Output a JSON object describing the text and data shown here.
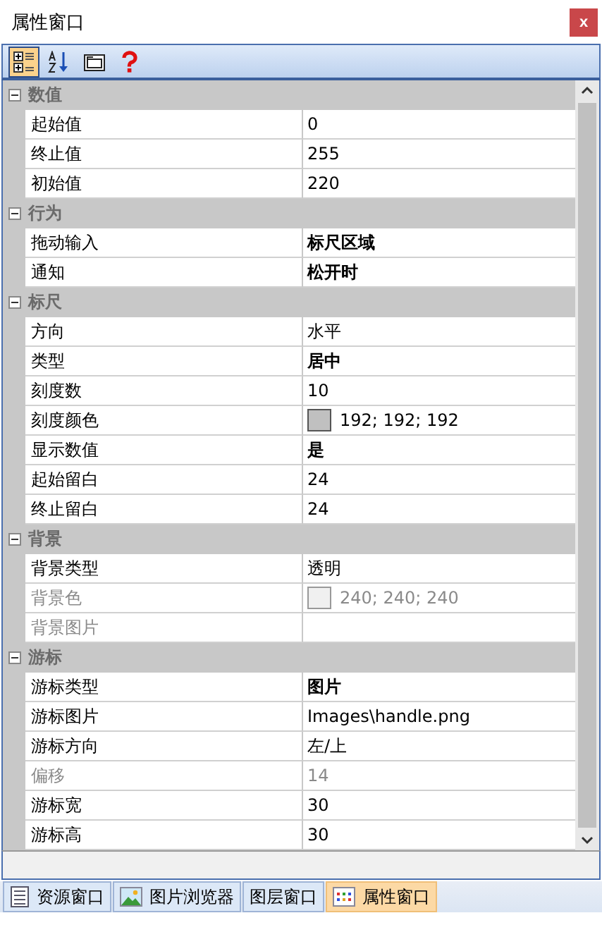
{
  "window": {
    "title": "属性窗口",
    "close": "x"
  },
  "toolbar": [
    {
      "kind": "categorized",
      "selected": true
    },
    {
      "kind": "alphabetical",
      "selected": false
    },
    {
      "kind": "pages",
      "selected": false
    },
    {
      "kind": "help",
      "selected": false
    }
  ],
  "categories": [
    {
      "name": "数值",
      "expanded": true,
      "properties": [
        {
          "name": "起始值",
          "value": "0",
          "bold": false,
          "disabled": false
        },
        {
          "name": "终止值",
          "value": "255",
          "bold": false,
          "disabled": false
        },
        {
          "name": "初始值",
          "value": "220",
          "bold": false,
          "disabled": false
        }
      ]
    },
    {
      "name": "行为",
      "expanded": true,
      "properties": [
        {
          "name": "拖动输入",
          "value": "标尺区域",
          "bold": true,
          "disabled": false
        },
        {
          "name": "通知",
          "value": "松开时",
          "bold": true,
          "disabled": false
        }
      ]
    },
    {
      "name": "标尺",
      "expanded": true,
      "properties": [
        {
          "name": "方向",
          "value": "水平",
          "bold": false,
          "disabled": false
        },
        {
          "name": "类型",
          "value": "居中",
          "bold": true,
          "disabled": false
        },
        {
          "name": "刻度数",
          "value": "10",
          "bold": false,
          "disabled": false
        },
        {
          "name": "刻度颜色",
          "value": "192; 192; 192",
          "bold": false,
          "disabled": false,
          "color": "#c0c0c0"
        },
        {
          "name": "显示数值",
          "value": "是",
          "bold": true,
          "disabled": false
        },
        {
          "name": "起始留白",
          "value": "24",
          "bold": false,
          "disabled": false
        },
        {
          "name": "终止留白",
          "value": "24",
          "bold": false,
          "disabled": false
        }
      ]
    },
    {
      "name": "背景",
      "expanded": true,
      "properties": [
        {
          "name": "背景类型",
          "value": "透明",
          "bold": false,
          "disabled": false
        },
        {
          "name": "背景色",
          "value": "240; 240; 240",
          "bold": false,
          "disabled": true,
          "color": "#f0f0f0"
        },
        {
          "name": "背景图片",
          "bold": false,
          "disabled": true
        }
      ]
    },
    {
      "name": "游标",
      "expanded": true,
      "properties": [
        {
          "name": "游标类型",
          "value": "图片",
          "bold": true,
          "disabled": false
        },
        {
          "name": "游标图片",
          "value": "Images\\handle.png",
          "bold": false,
          "disabled": false
        },
        {
          "name": "游标方向",
          "value": "左/上",
          "bold": false,
          "disabled": false
        },
        {
          "name": "偏移",
          "value": "14",
          "bold": false,
          "disabled": true
        },
        {
          "name": "游标宽",
          "value": "30",
          "bold": false,
          "disabled": false
        },
        {
          "name": "游标高",
          "value": "30",
          "bold": false,
          "disabled": false
        }
      ]
    }
  ],
  "tabs": [
    {
      "label": "资源窗口",
      "kind": "document",
      "selected": false
    },
    {
      "label": "图片浏览器",
      "kind": "image",
      "selected": false
    },
    {
      "label": "图层窗口",
      "kind": "plain",
      "selected": false
    },
    {
      "label": "属性窗口",
      "kind": "grid",
      "selected": true
    }
  ]
}
